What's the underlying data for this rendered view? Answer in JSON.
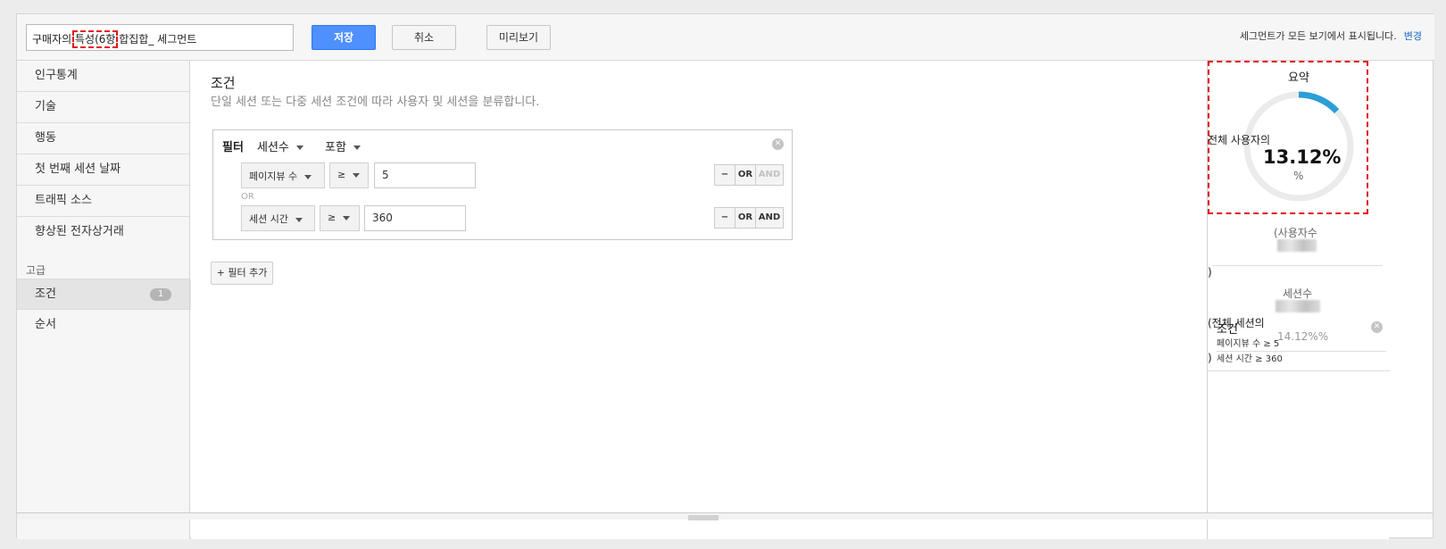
{
  "toolbar": {
    "segment_name_pre": "구매자의 ",
    "segment_name_hl": "특성(6항",
    "segment_name_post": " 합집합_ 세그먼트",
    "save_label": "저장",
    "cancel_label": "취소",
    "preview_label": "미리보기",
    "notice": "세그먼트가 모든 보기에서 표시됩니다.",
    "change_link": "변경"
  },
  "sidebar": {
    "items": [
      {
        "label": "인구통계"
      },
      {
        "label": "기술"
      },
      {
        "label": "행동"
      },
      {
        "label": "첫 번째 세션 날짜"
      },
      {
        "label": "트래픽 소스"
      },
      {
        "label": "향상된 전자상거래"
      }
    ],
    "advanced_label": "고급",
    "advanced_items": [
      {
        "label": "조건",
        "badge": "1",
        "active": true
      },
      {
        "label": "순서"
      }
    ]
  },
  "main": {
    "title": "조건",
    "description": "단일 세션 또는 다중 세션 조건에 따라 사용자 및 세션을 분류합니다.",
    "filter": {
      "label": "필터",
      "scope": "세션수",
      "mode": "포함",
      "rows": [
        {
          "dimension": "페이지뷰 수",
          "operator": "≥",
          "value": "5",
          "ops": [
            "−",
            "OR",
            "AND"
          ]
        },
        {
          "dimension": "세션 시간",
          "operator": "≥",
          "value": "360",
          "ops": [
            "−",
            "OR",
            "AND"
          ]
        }
      ],
      "or_label": "OR"
    },
    "add_filter_label": "+ 필터 추가"
  },
  "summary": {
    "title": "요약",
    "percent_prefix": "전체 사용자의",
    "percent_value": "13.12%",
    "percent_unit": "%",
    "donut_fraction": 0.1312,
    "donut_color": "#2a9fd6",
    "users_label": "(사용자수",
    "paren_close_1": ")",
    "sessions_label": "세션수",
    "sessions_prefix": "(전체 세션의",
    "sessions_percent": "14.12%%",
    "paren_close_2": ")",
    "conditions_title": "조건",
    "conditions": [
      "페이지뷰 수 ≥ 5",
      "세션 시간 ≥ 360"
    ]
  }
}
